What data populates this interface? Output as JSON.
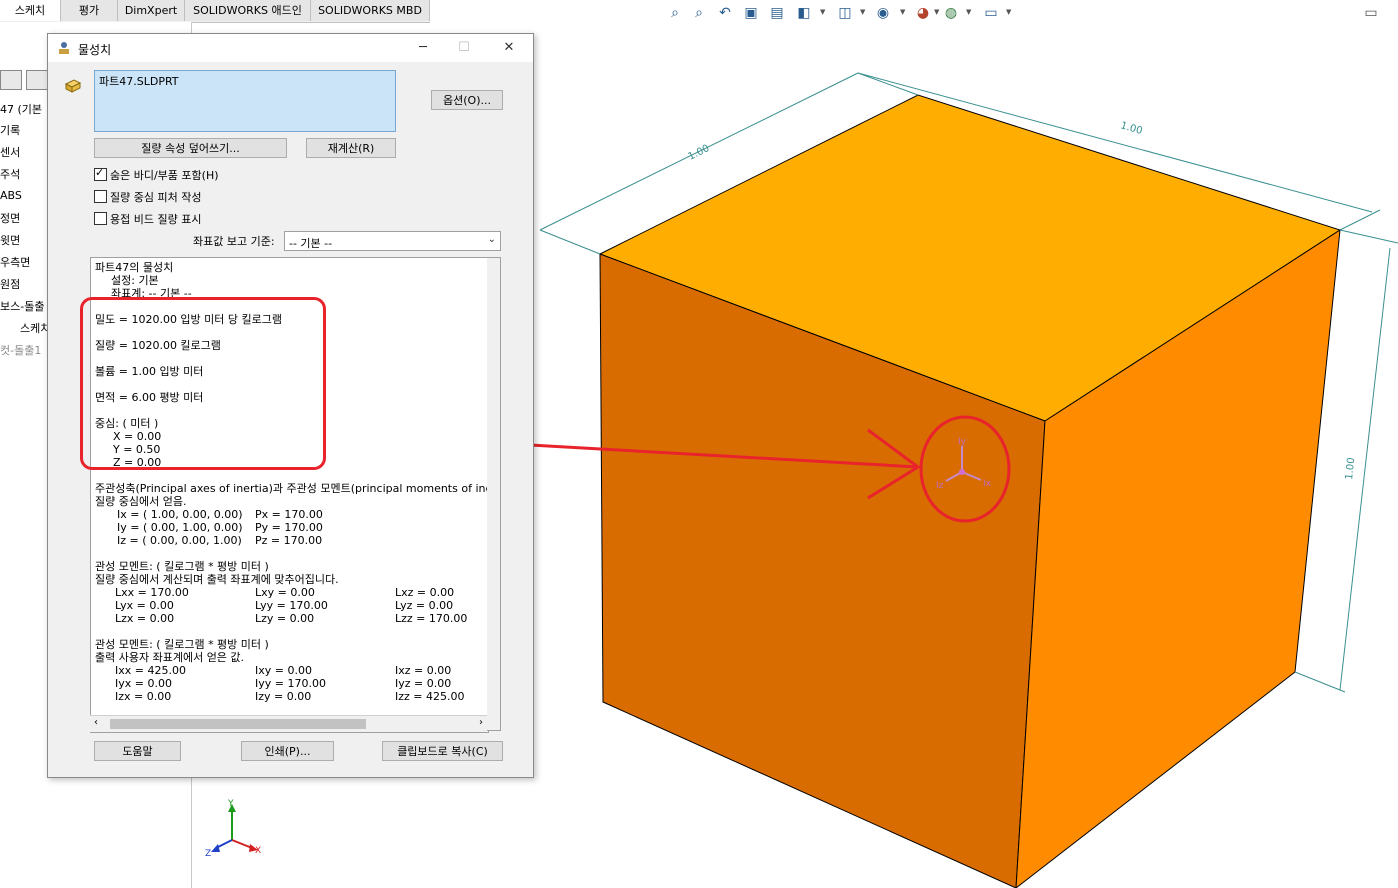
{
  "tabs": [
    "스케치",
    "평가",
    "DimXpert",
    "SOLIDWORKS 애드인",
    "SOLIDWORKS MBD"
  ],
  "active_tab": "스케치",
  "toolbar_icons": [
    "zoom-fit-icon",
    "zoom-area-icon",
    "previous-view-icon",
    "section-view-icon",
    "dynamic-annotation-icon",
    "view-orientation-icon",
    "display-style-icon",
    "hide-show-icon",
    "edit-appearance-icon",
    "apply-scene-icon",
    "view-settings-icon"
  ],
  "feature_tree": {
    "items": [
      "47  (기본",
      "기록",
      "센서",
      "주석",
      "ABS",
      "정면",
      "윗면",
      "우측면",
      "원점",
      "보스-돌출",
      "스케치",
      "컷-돌출1"
    ]
  },
  "dialog": {
    "title": "물성치",
    "file_name": "파트47.SLDPRT",
    "options_button": "옵션(O)...",
    "override_button": "질량 속성 덮어쓰기...",
    "recalc_button": "재계산(R)",
    "checkboxes": [
      {
        "label": "숨은 바디/부품 포함(H)",
        "checked": true
      },
      {
        "label": "질량 중심 피처 작성",
        "checked": false
      },
      {
        "label": "용접 비드 질량 표시",
        "checked": false
      }
    ],
    "coord_label": "좌표값 보고 기준:",
    "coord_value": "-- 기본 --",
    "help_button": "도움말",
    "print_button": "인쇄(P)...",
    "copy_button": "클립보드로 복사(C)"
  },
  "results": {
    "header": "파트47의 물성치",
    "config": "설정: 기본",
    "coord": "좌표계: -- 기본 --",
    "density": "밀도 = 1020.00 입방 미터 당 킬로그램",
    "mass": "질량 = 1020.00 킬로그램",
    "volume": "볼륨 = 1.00 입방 미터",
    "area": "면적 = 6.00 평방 미터",
    "com_title": "중심: ( 미터 )",
    "com_x": "X = 0.00",
    "com_y": "Y = 0.50",
    "com_z": "Z = 0.00",
    "principal_title": "주관성축(Principal axes of inertia)과 주관성 모멘트(principal moments of ine",
    "principal_sub": "질량 중심에서 얻음.",
    "principal_rows": [
      [
        "Ix = ( 1.00,  0.00,  0.00)",
        "Px = 170.00"
      ],
      [
        "Iy = ( 0.00,  1.00,  0.00)",
        "Py = 170.00"
      ],
      [
        "Iz = ( 0.00,  0.00,  1.00)",
        "Pz = 170.00"
      ]
    ],
    "moments1_title": "관성 모멘트: ( 킬로그램 * 평방 미터 )",
    "moments1_sub": "질량 중심에서 계산되며 출력 좌표계에 맞추어집니다.",
    "moments1_rows": [
      [
        "Lxx = 170.00",
        "Lxy = 0.00",
        "Lxz = 0.00"
      ],
      [
        "Lyx = 0.00",
        "Lyy = 170.00",
        "Lyz = 0.00"
      ],
      [
        "Lzx = 0.00",
        "Lzy = 0.00",
        "Lzz = 170.00"
      ]
    ],
    "moments2_title": "관성 모멘트: ( 킬로그램 * 평방 미터 )",
    "moments2_sub": "출력 사용자 좌표계에서 얻은 값.",
    "moments2_rows": [
      [
        "Ixx = 425.00",
        "Ixy = 0.00",
        "Ixz = 0.00"
      ],
      [
        "Iyx = 0.00",
        "Iyy = 170.00",
        "Iyz = 0.00"
      ],
      [
        "Izx = 0.00",
        "Izy = 0.00",
        "Izz = 425.00"
      ]
    ]
  },
  "viewport": {
    "dim_top": "1.00",
    "dim_left": "1.00",
    "dim_right": "1.00",
    "com_axes": [
      "Iy",
      "Iz",
      "Ix"
    ],
    "triad_axes": [
      "Y",
      "Z",
      "X"
    ],
    "cube_colors": {
      "top": "#ffad00",
      "left": "#d96c00",
      "right": "#ff8c00"
    },
    "annotation_color": "#e8232c"
  }
}
